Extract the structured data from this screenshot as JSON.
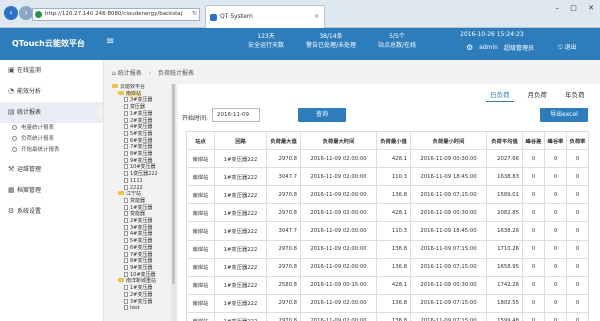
{
  "browser": {
    "url": "http://120.27.140.246:8080/cloudenergy/backstaj",
    "tab_title": "QT System"
  },
  "header": {
    "app_title": "QTouch云能效平台",
    "stats": [
      {
        "value": "123天",
        "label": "安全运行天数"
      },
      {
        "value": "38/14条",
        "label": "警告已处理/未处理"
      },
      {
        "value": "5/5个",
        "label": "站点总数/在线"
      }
    ],
    "datetime": "2016-10-26 15:24:23",
    "user": "admin",
    "role": "超级管理员",
    "logout": "退出"
  },
  "sidebar": {
    "items": [
      {
        "label": "在线监测",
        "icon": "monitor-icon"
      },
      {
        "label": "能效分析",
        "icon": "analysis-icon"
      },
      {
        "label": "统计报表",
        "icon": "report-icon",
        "active": true
      },
      {
        "label": "运维管理",
        "icon": "maintenance-icon"
      },
      {
        "label": "档案管理",
        "icon": "archive-icon"
      },
      {
        "label": "系统设置",
        "icon": "settings-icon"
      }
    ],
    "subitems": [
      "电量统计报表",
      "负荷统计报表",
      "开始最统计报表"
    ]
  },
  "breadcrumb": {
    "root": "统计报表",
    "current": "负荷统计报表"
  },
  "tree": [
    {
      "label": "云能效平台",
      "type": "folder",
      "depth": 0
    },
    {
      "label": "南岸站",
      "type": "folder",
      "depth": 1,
      "selected": true
    },
    {
      "label": "3#变压器",
      "type": "file",
      "depth": 2
    },
    {
      "label": "变压器",
      "type": "file",
      "depth": 2
    },
    {
      "label": "1#变压器",
      "type": "file",
      "depth": 2
    },
    {
      "label": "2#变压器",
      "type": "file",
      "depth": 2
    },
    {
      "label": "4#变压器",
      "type": "file",
      "depth": 2
    },
    {
      "label": "5#变压器",
      "type": "file",
      "depth": 2
    },
    {
      "label": "6#变压器",
      "type": "file",
      "depth": 2
    },
    {
      "label": "7#变压器",
      "type": "file",
      "depth": 2
    },
    {
      "label": "8#变压器",
      "type": "file",
      "depth": 2
    },
    {
      "label": "9#变压器",
      "type": "file",
      "depth": 2
    },
    {
      "label": "10#变压器",
      "type": "file",
      "depth": 2
    },
    {
      "label": "1变压器222",
      "type": "file",
      "depth": 2
    },
    {
      "label": "1111",
      "type": "file",
      "depth": 2
    },
    {
      "label": "2222",
      "type": "file",
      "depth": 2
    },
    {
      "label": "江宁站",
      "type": "folder",
      "depth": 1
    },
    {
      "label": "变能器",
      "type": "file",
      "depth": 2
    },
    {
      "label": "1#变压器",
      "type": "file",
      "depth": 2
    },
    {
      "label": "变能器",
      "type": "file",
      "depth": 2
    },
    {
      "label": "2#变压器",
      "type": "file",
      "depth": 2
    },
    {
      "label": "3#变压器",
      "type": "file",
      "depth": 2
    },
    {
      "label": "4#变压器",
      "type": "file",
      "depth": 2
    },
    {
      "label": "5#变压器",
      "type": "file",
      "depth": 2
    },
    {
      "label": "6#变压器",
      "type": "file",
      "depth": 2
    },
    {
      "label": "7#变压器",
      "type": "file",
      "depth": 2
    },
    {
      "label": "8#变压器",
      "type": "file",
      "depth": 2
    },
    {
      "label": "9#变压器",
      "type": "file",
      "depth": 2
    },
    {
      "label": "10#变压器",
      "type": "file",
      "depth": 2
    },
    {
      "label": "南洋新城重站",
      "type": "folder",
      "depth": 1
    },
    {
      "label": "1#变压器",
      "type": "file",
      "depth": 2
    },
    {
      "label": "2#变压器",
      "type": "file",
      "depth": 2
    },
    {
      "label": "3#变压器",
      "type": "file",
      "depth": 2
    },
    {
      "label": "test",
      "type": "file",
      "depth": 2
    }
  ],
  "panel": {
    "period_tabs": [
      {
        "label": "日负荷",
        "active": true
      },
      {
        "label": "月负荷"
      },
      {
        "label": "年负荷"
      }
    ],
    "start_label": "开始时间:",
    "date_value": "2016-11-09",
    "query_label": "查询",
    "export_label": "导出excel"
  },
  "table": {
    "headers": [
      "站点",
      "回路",
      "负荷最大值",
      "负荷最大时间",
      "负荷最小值",
      "负荷最小时间",
      "负荷平均值",
      "峰谷差",
      "峰谷率",
      "负荷率"
    ],
    "rows": [
      [
        "南岸站",
        "1#变压器222",
        "2970.8",
        "2016-11-09 02:00:00",
        "428.1",
        "2016-11-09 00:30:00",
        "2027.66",
        "0",
        "0",
        "0"
      ],
      [
        "南岸站",
        "1#变压器222",
        "3047.7",
        "2016-11-09 02:00:00",
        "110.3",
        "2016-11-09 18:45:00",
        "1638.83",
        "0",
        "0",
        "0"
      ],
      [
        "南岸站",
        "1#变压器222",
        "2970.8",
        "2016-11-09 02:00:00",
        "136.8",
        "2016-11-09 07:15:00",
        "1589.01",
        "0",
        "0",
        "0"
      ],
      [
        "南岸站",
        "1#变压器222",
        "2970.8",
        "2016-11-09 02:00:00",
        "428.1",
        "2016-11-09 00:30:00",
        "2082.85",
        "0",
        "0",
        "0"
      ],
      [
        "南岸站",
        "1#变压器222",
        "3047.7",
        "2016-11-09 02:00:00",
        "110.3",
        "2016-11-09 18:45:00",
        "1638.26",
        "0",
        "0",
        "0"
      ],
      [
        "南岸站",
        "1#变压器222",
        "2970.8",
        "2016-11-09 02:00:00",
        "136.8",
        "2016-11-09 07:15:00",
        "1710.26",
        "0",
        "0",
        "0"
      ],
      [
        "南岸站",
        "1#变压器222",
        "2970.8",
        "2016-11-09 02:00:00",
        "136.8",
        "2016-11-09 07:15:00",
        "1658.95",
        "0",
        "0",
        "0"
      ],
      [
        "南岸站",
        "1#变压器222",
        "2580.8",
        "2016-11-09 00:15:00",
        "428.1",
        "2016-11-09 00:30:00",
        "1742.28",
        "0",
        "0",
        "0"
      ],
      [
        "南岸站",
        "1#变压器222",
        "2970.8",
        "2016-11-09 02:00:00",
        "136.8",
        "2016-11-09 07:15:00",
        "1802.55",
        "0",
        "0",
        "0"
      ],
      [
        "南岸站",
        "1#变压器222",
        "2970.8",
        "2016-11-09 02:00:00",
        "136.8",
        "2016-11-09 07:15:00",
        "1599.48",
        "0",
        "0",
        "0"
      ]
    ]
  }
}
